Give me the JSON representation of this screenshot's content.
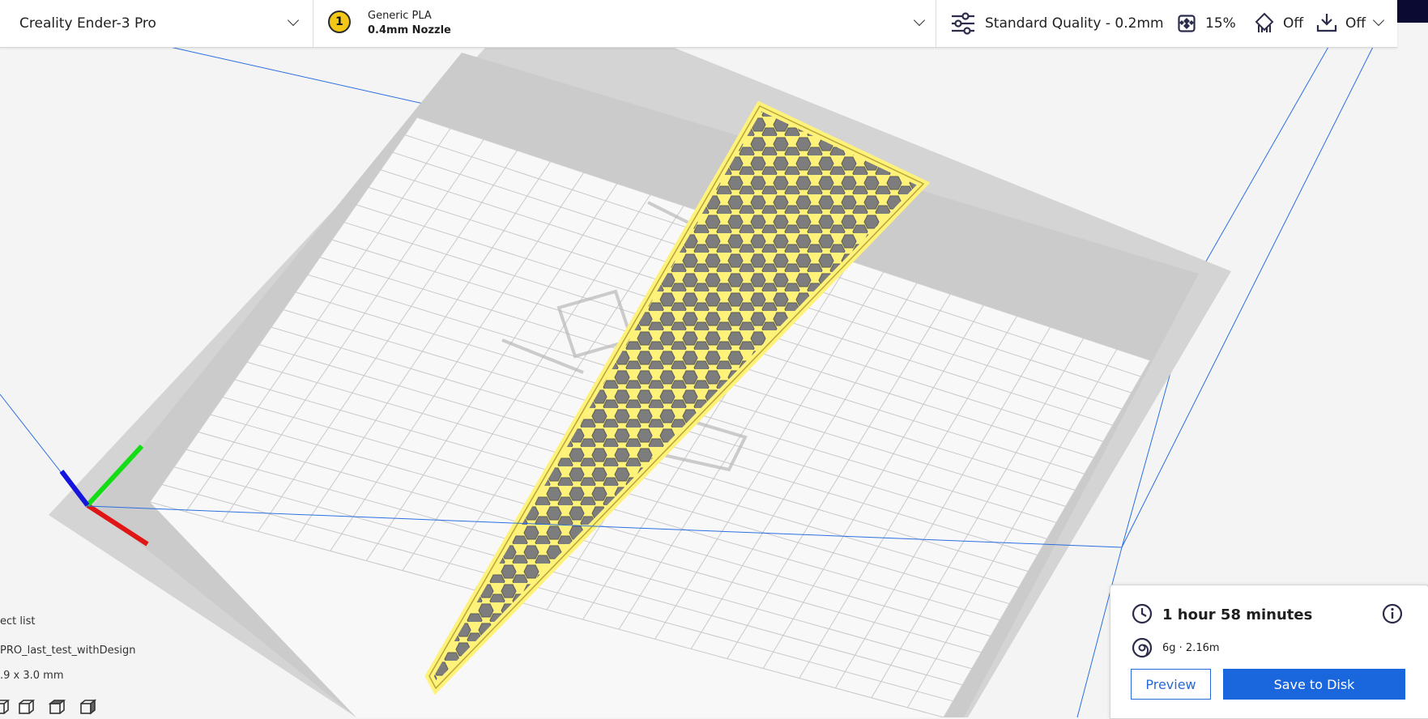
{
  "printer": {
    "name": "Creality Ender-3 Pro"
  },
  "material": {
    "extruder_number": "1",
    "name": "Generic PLA",
    "nozzle": "0.4mm Nozzle"
  },
  "print_settings": {
    "quality": "Standard Quality - 0.2mm",
    "infill": "15%",
    "support": "Off",
    "adhesion": "Off"
  },
  "object_panel": {
    "list_label": "ect list",
    "object_name": "PRO_last_test_withDesign",
    "dimensions": ".9 x 3.0 mm"
  },
  "print_panel": {
    "time": "1 hour 58 minutes",
    "material_usage": "6g · 2.16m",
    "preview_label": "Preview",
    "save_label": "Save to Disk"
  },
  "colors": {
    "model": "#fff27a",
    "accent": "#1a66dc",
    "bed": "#f9f9f9",
    "grid": "#c9c9c9",
    "axis_x": "#e01515",
    "axis_y": "#15dd15",
    "axis_z": "#1515dd"
  }
}
